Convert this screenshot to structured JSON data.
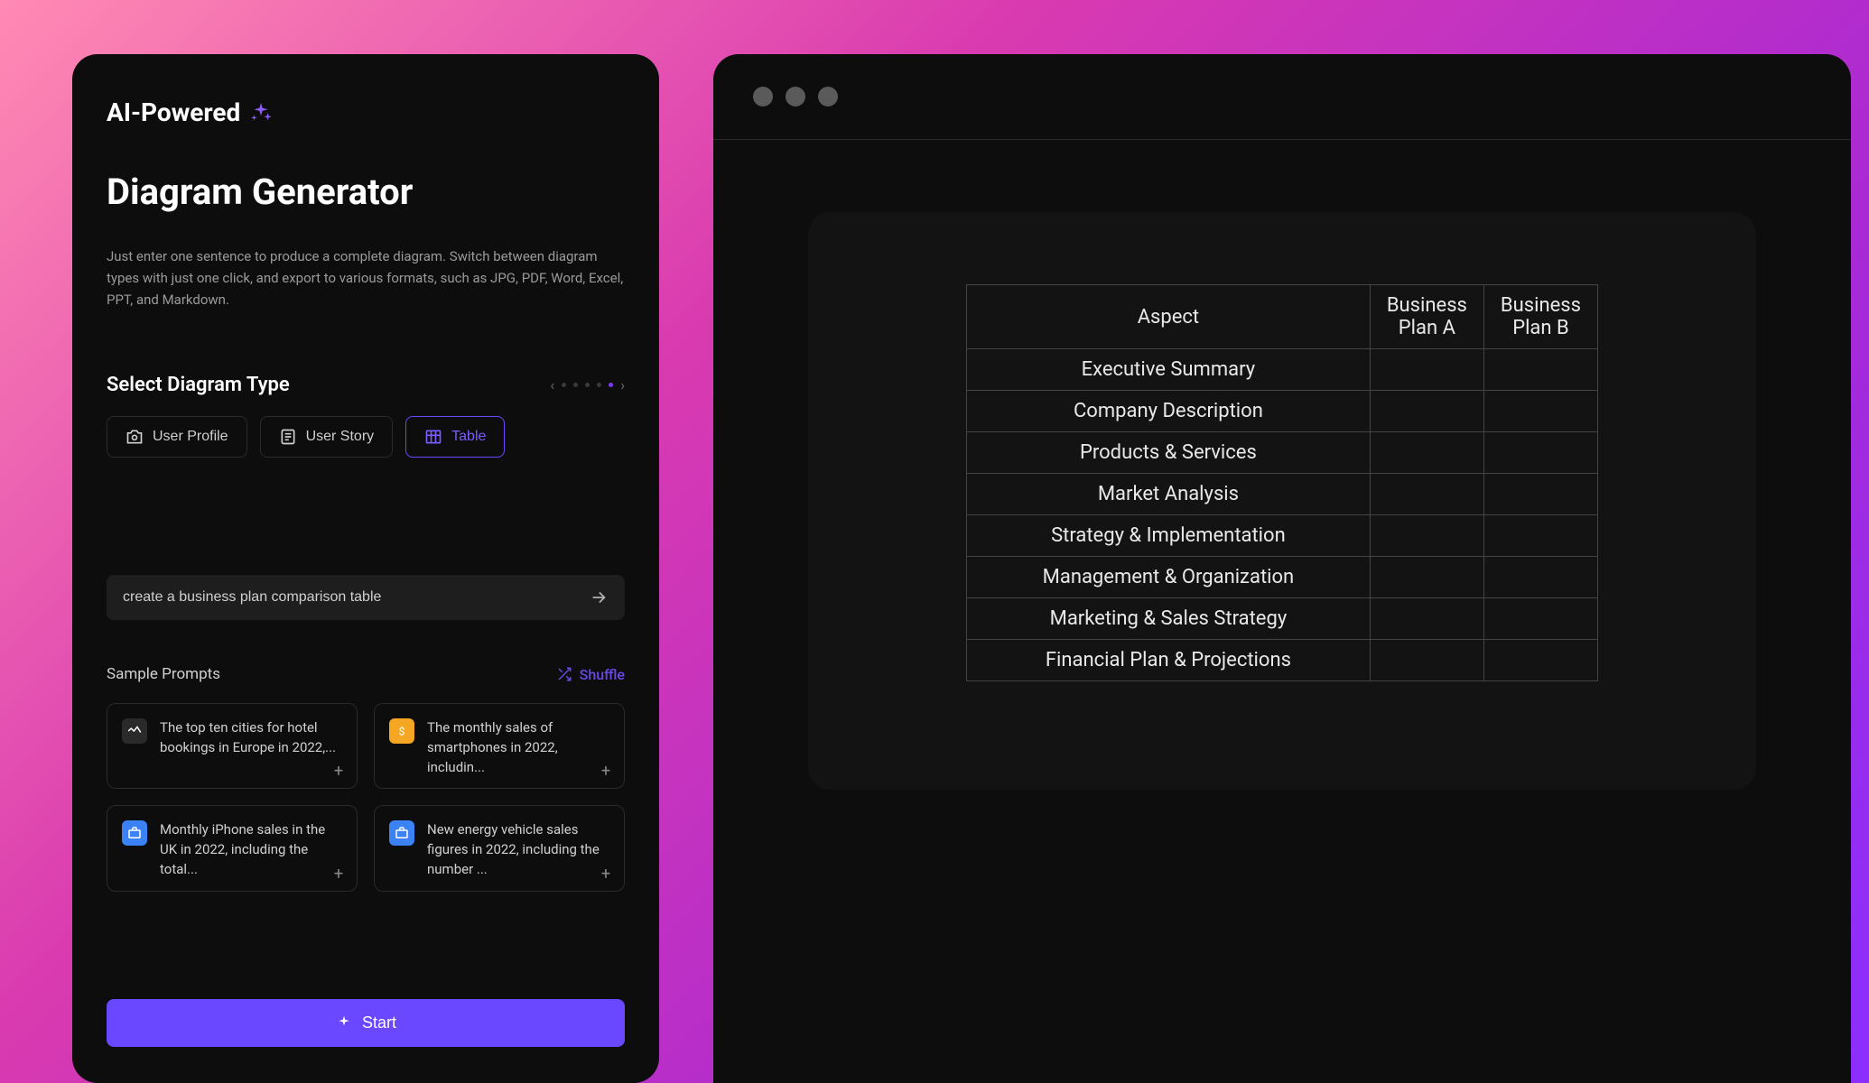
{
  "left": {
    "ai_label": "AI-Powered",
    "title": "Diagram Generator",
    "description": "Just enter one sentence to produce a complete diagram. Switch between diagram types with just one click, and export to various formats, such as JPG, PDF, Word, Excel, PPT, and Markdown.",
    "section_label": "Select Diagram Type",
    "types": {
      "user_profile": "User Profile",
      "user_story": "User Story",
      "table": "Table"
    },
    "input_value": "create a business plan comparison table",
    "prompts_label": "Sample Prompts",
    "shuffle_label": "Shuffle",
    "prompts": [
      "The top ten cities for hotel bookings in Europe in 2022,...",
      "The monthly sales of smartphones in 2022, includin...",
      "Monthly iPhone sales in the UK in 2022, including the total...",
      "New energy vehicle sales figures in 2022, including the number ..."
    ],
    "start_label": "Start"
  },
  "preview": {
    "headers": [
      "Aspect",
      "Business Plan A",
      "Business Plan B"
    ],
    "rows": [
      "Executive Summary",
      "Company Description",
      "Products & Services",
      "Market Analysis",
      "Strategy & Implementation",
      "Management & Organization",
      "Marketing & Sales Strategy",
      "Financial Plan & Projections"
    ]
  }
}
